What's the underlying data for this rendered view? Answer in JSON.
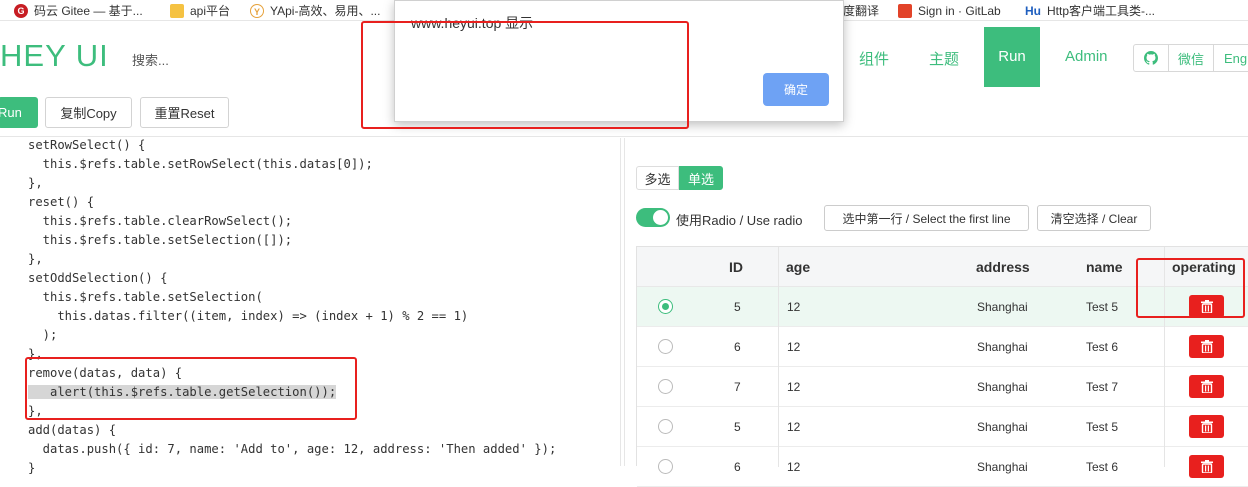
{
  "bookmarks": [
    {
      "label": "码云 Gitee — 基于...",
      "icon": "gitee-icon",
      "color": "#c71d23"
    },
    {
      "label": "api平台",
      "icon": "folder-icon",
      "color": "#f5c242"
    },
    {
      "label": "YApi-高效、易用、...",
      "icon": "yapi-icon",
      "color": "#e6a23c"
    },
    {
      "label": "度翻译",
      "icon": "",
      "color": ""
    },
    {
      "label": "Sign in · GitLab",
      "icon": "gitlab-icon",
      "color": "#e24329"
    },
    {
      "label": "Http客户端工具类-...",
      "icon": "hu-icon",
      "color": "#1f5fbf"
    }
  ],
  "bookmark_hu": "Hu",
  "header": {
    "logo": "HEY UI",
    "search": "搜索...",
    "nav": [
      "组件",
      "主题",
      "Run",
      "Admin"
    ],
    "github": "",
    "wechat": "微信",
    "lang": "Engl"
  },
  "toolbar": {
    "run": "Run",
    "copy": "复制Copy",
    "reset": "重置Reset"
  },
  "dialog": {
    "title": "www.heyui.top 显示",
    "ok": "确定"
  },
  "code": {
    "lines": [
      "setRowSelect() {",
      "  this.$refs.table.setRowSelect(this.datas[0]);",
      "},",
      "reset() {",
      "  this.$refs.table.clearRowSelect();",
      "  this.$refs.table.setSelection([]);",
      "},",
      "setOddSelection() {",
      "  this.$refs.table.setSelection(",
      "    this.datas.filter((item, index) => (index + 1) % 2 == 1)",
      "  );",
      "},",
      "remove(datas, data) {",
      "   alert(this.$refs.table.getSelection());",
      "},",
      "add(datas) {",
      "  datas.push({ id: 7, name: 'Add to', age: 12, address: 'Then added' });",
      "}"
    ]
  },
  "panel": {
    "tab_multi": "多选",
    "tab_single": "单选",
    "radio_toggle": "使用Radio / Use radio",
    "select_first": "选中第一行 / Select the first line",
    "clear": "清空选择 / Clear"
  },
  "table": {
    "headers": {
      "id": "ID",
      "age": "age",
      "address": "address",
      "name": "name",
      "operating": "operating"
    },
    "rows": [
      {
        "id": "5",
        "age": "12",
        "address": "Shanghai",
        "name": "Test 5",
        "selected": true
      },
      {
        "id": "6",
        "age": "12",
        "address": "Shanghai",
        "name": "Test 6",
        "selected": false
      },
      {
        "id": "7",
        "age": "12",
        "address": "Shanghai",
        "name": "Test 7",
        "selected": false
      },
      {
        "id": "5",
        "age": "12",
        "address": "Shanghai",
        "name": "Test 5",
        "selected": false
      },
      {
        "id": "6",
        "age": "12",
        "address": "Shanghai",
        "name": "Test 6",
        "selected": false
      }
    ]
  },
  "colors": {
    "brand": "#3dbd7d",
    "danger": "#e8201e",
    "dialog_button": "#6ea2f4",
    "annotation": "#e8201e"
  }
}
